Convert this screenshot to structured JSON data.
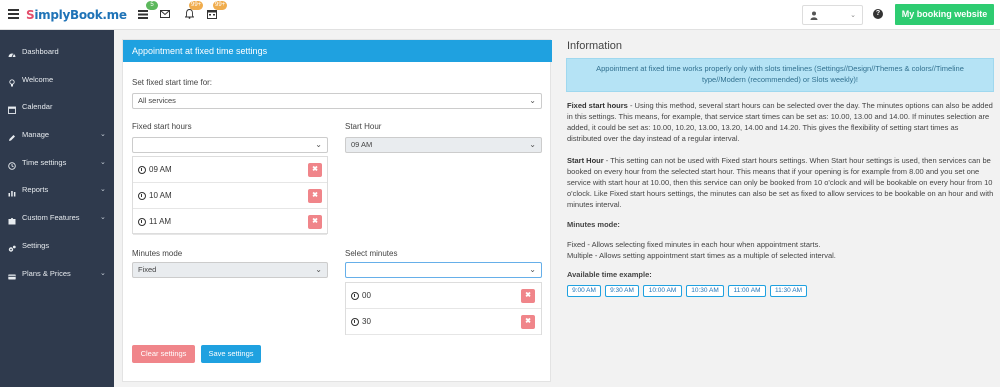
{
  "header": {
    "logo_main": "SimplyBook.me",
    "badges": {
      "tasks": "5",
      "notifications": "99+",
      "calendar": "99+"
    },
    "booking_button": "My booking website"
  },
  "sidebar": {
    "items": [
      {
        "label": "Dashboard",
        "icon": "dashboard-icon",
        "has_submenu": false
      },
      {
        "label": "Welcome",
        "icon": "lightbulb-icon",
        "has_submenu": false
      },
      {
        "label": "Calendar",
        "icon": "calendar-icon",
        "has_submenu": false
      },
      {
        "label": "Manage",
        "icon": "pencil-icon",
        "has_submenu": true
      },
      {
        "label": "Time settings",
        "icon": "clock-icon",
        "has_submenu": true
      },
      {
        "label": "Reports",
        "icon": "bar-chart-icon",
        "has_submenu": true
      },
      {
        "label": "Custom Features",
        "icon": "puzzle-icon",
        "has_submenu": true
      },
      {
        "label": "Settings",
        "icon": "gears-icon",
        "has_submenu": false
      },
      {
        "label": "Plans & Prices",
        "icon": "credit-card-icon",
        "has_submenu": true
      }
    ]
  },
  "panel": {
    "title": "Appointment at fixed time settings",
    "set_for_label": "Set fixed start time for:",
    "set_for_value": "All services",
    "fixed_hours_label": "Fixed start hours",
    "fixed_hours_value": "",
    "start_hour_label": "Start Hour",
    "start_hour_value": "09 AM",
    "fixed_hours": [
      "09 AM",
      "10 AM",
      "11 AM"
    ],
    "minutes_mode_label": "Minutes mode",
    "minutes_mode_value": "Fixed",
    "select_minutes_label": "Select minutes",
    "select_minutes_value": "",
    "minutes": [
      "00",
      "30"
    ],
    "clear_button": "Clear settings",
    "save_button": "Save settings"
  },
  "info": {
    "title": "Information",
    "alert": "Appointment at fixed time works properly only with slots timelines (Settings//Design//Themes & colors//Timeline type//Modern (recommended) or Slots weekly)!",
    "fixed_heading": "Fixed start hours",
    "fixed_text": " - Using this method, several start hours can be selected over the day. The minutes options can also be added in this settings. This means, for example, that service start times can be set as: 10.00, 13.00 and 14.00. If minutes selection are added, it could be set as: 10.00, 10.20, 13.00, 13.20, 14.00 and 14.20. This gives the flexibility of setting start times as distributed over the day instead of a regular interval.",
    "start_heading": "Start Hour",
    "start_text": " - This setting can not be used with Fixed start hours settings. When Start hour settings is used, then services can be booked on every hour from the selected start hour. This means that if your opening is for example from 8.00 and you set one service with start hour at 10.00, then this service can only be booked from 10 o'clock and will be bookable on every hour from 10 o'clock. Like Fixed start hours settings, the minutes can also be set as fixed to allow services to be bookable on an hour and with minutes interval.",
    "minutes_heading": "Minutes mode:",
    "minutes_fixed": "Fixed - Allows selecting fixed minutes in each hour when appointment starts.",
    "minutes_multiple": "Multiple - Allows setting appointment start times as a multiple of selected interval.",
    "example_heading": "Available time example:",
    "example_times": [
      "9:00 AM",
      "9:30 AM",
      "10:00 AM",
      "10:30 AM",
      "11:00 AM",
      "11:30 AM"
    ]
  }
}
